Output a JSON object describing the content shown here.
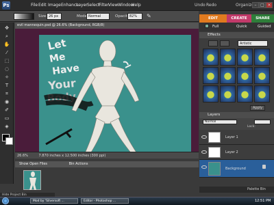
{
  "menu": {
    "items": [
      "File",
      "Edit",
      "Image",
      "Enhance",
      "Layer",
      "Select",
      "Filter",
      "View",
      "Window",
      "Help"
    ],
    "undo": "Undo",
    "redo": "Redo",
    "organizer": "Organizer"
  },
  "options": {
    "size_label": "Size:",
    "size_value": "26 px",
    "mode_label": "Mode:",
    "mode_value": "Normal",
    "opacity_label": "Opacity:",
    "opacity_value": "82%"
  },
  "mode_tabs": {
    "edit": "EDIT",
    "create": "CREATE",
    "share": "SHARE"
  },
  "palette_tabs": {
    "full": "Full",
    "quick": "Quick",
    "guided": "Guided"
  },
  "document": {
    "title": "evil mannequin.psd @ 26.6% (Background, RGB/8)",
    "zoom": "26.6%",
    "dimensions": "7.870 inches x 12.500 inches (300 ppi)",
    "canvas_text": [
      "Let",
      "Me",
      "Have",
      "Your",
      "Body"
    ]
  },
  "project_bin": {
    "show": "Show Open Files",
    "bin_actions": "Bin Actions",
    "hide": "Hide Project Bin"
  },
  "effects": {
    "title": "Effects",
    "category": "Artistic",
    "apply": "Apply"
  },
  "layers": {
    "title": "Layers",
    "blend_mode": "Normal",
    "lock": "Lock:",
    "rows": [
      {
        "name": "Layer 1"
      },
      {
        "name": "Layer 2"
      },
      {
        "name": "Background"
      }
    ]
  },
  "palette_bin": "Palette Bin",
  "taskbar": {
    "tasks": [
      "Mod by 'Silversoft ...",
      "Editor - Photoshop ..."
    ],
    "clock": "12:51 PM"
  },
  "colors": {
    "canvas": "#3a918c",
    "workspace": "#4a1c3a",
    "edit_tab": "#e07a1f",
    "create_tab": "#c23a6a",
    "share_tab": "#2e7e3a",
    "selected_layer": "#2a5f9a"
  }
}
